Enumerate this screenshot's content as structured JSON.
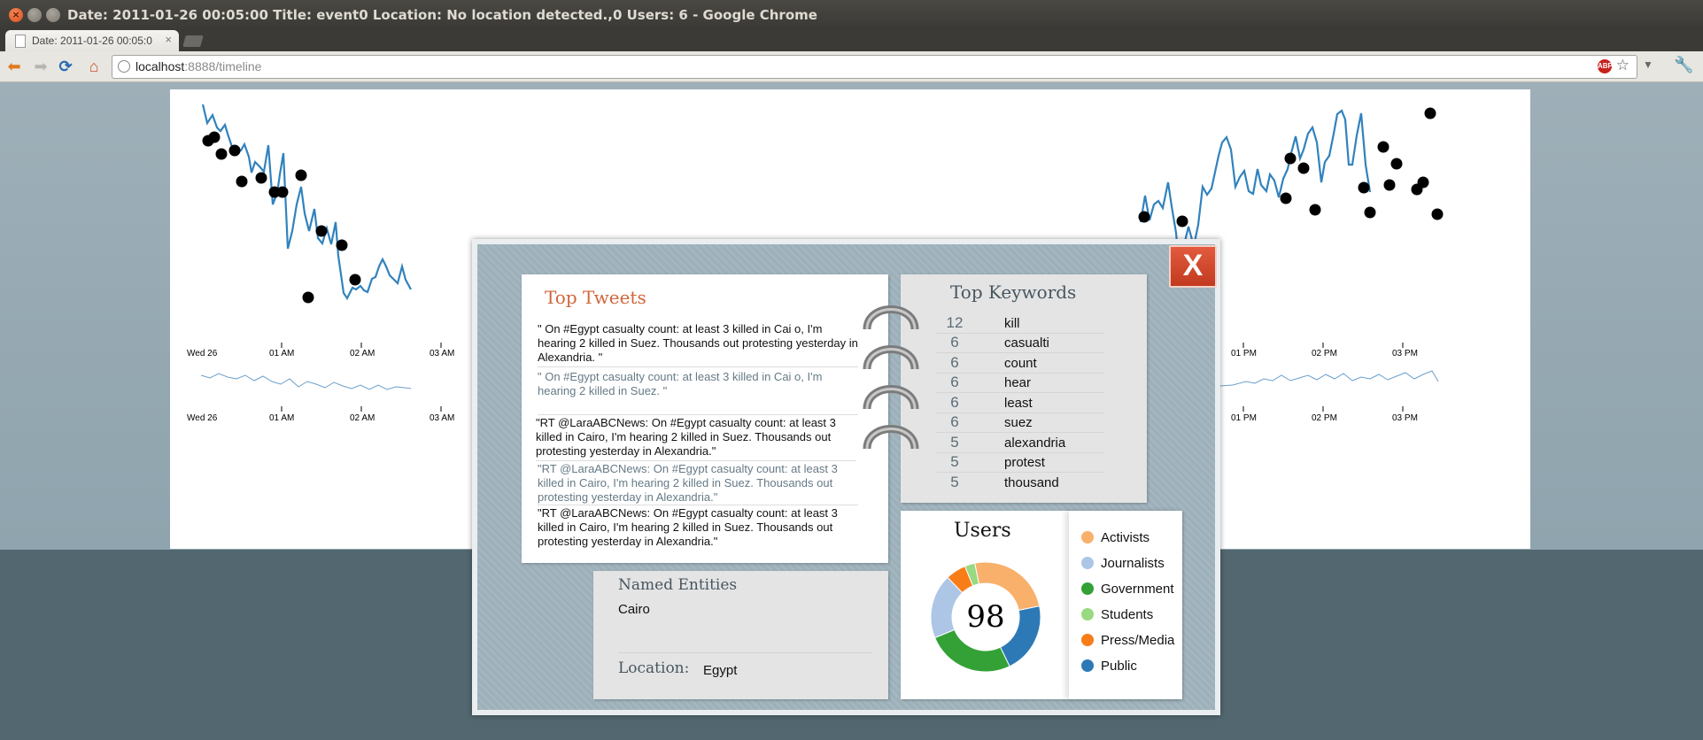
{
  "window": {
    "title": "Date: 2011-01-26 00:05:00 Title: event0 Location: No location detected.,0 Users: 6 - Google Chrome"
  },
  "tab": {
    "title": "Date: 2011-01-26 00:05:0",
    "close": "×"
  },
  "toolbar": {
    "back": "⬅",
    "forward": "➡",
    "reload": "⟳",
    "home": "⌂",
    "url_host": "localhost",
    "url_rest": ":8888/timeline",
    "abp": "ABP",
    "star": "☆",
    "menu": "▼",
    "wrench": "🔧"
  },
  "timeline": {
    "upper_axis_left": [
      "Wed 26",
      "01 AM",
      "02 AM",
      "03 AM"
    ],
    "upper_axis_right": [
      "01 PM",
      "02 PM",
      "03 PM"
    ],
    "lower_axis_left": [
      "Wed 26",
      "01 AM",
      "02 AM",
      "03 AM"
    ],
    "lower_axis_right": [
      "01 PM",
      "02 PM",
      "03 PM"
    ]
  },
  "popup": {
    "close_label": "X",
    "top_tweets": {
      "title": "Top Tweets",
      "tweets": [
        "\" On #Egypt casualty count: at least 3 killed in Cai o, I'm hearing 2 killed in Suez. Thousands out protesting yesterday in Alexandria. \"",
        "\" On #Egypt casualty count: at least 3 killed in Cai o, I'm hearing 2 killed in Suez. \"",
        "\"RT @LaraABCNews: On #Egypt casualty count: at least 3 killed in Cairo, I'm hearing 2 killed in Suez. Thousands out protesting yesterday in Alexandria.\"",
        "\"RT @LaraABCNews: On #Egypt casualty count: at least 3 killed in Cairo, I'm hearing 2 killed in Suez. Thousands out protesting yesterday in Alexandria.\"",
        "\"RT @LaraABCNews: On #Egypt casualty count: at least 3 killed in Cairo, I'm hearing 2 killed in Suez. Thousands out protesting yesterday in Alexandria.\""
      ]
    },
    "top_keywords": {
      "title": "Top Keywords",
      "rows": [
        {
          "count": "12",
          "word": "kill"
        },
        {
          "count": "6",
          "word": "casualti"
        },
        {
          "count": "6",
          "word": "count"
        },
        {
          "count": "6",
          "word": "hear"
        },
        {
          "count": "6",
          "word": "least"
        },
        {
          "count": "6",
          "word": "suez"
        },
        {
          "count": "5",
          "word": "alexandria"
        },
        {
          "count": "5",
          "word": "protest"
        },
        {
          "count": "5",
          "word": "thousand"
        }
      ]
    },
    "named_entities": {
      "title": "Named Entities",
      "items": [
        "Cairo"
      ],
      "location_label": "Location:",
      "location_value": "Egypt"
    },
    "users": {
      "title": "Users",
      "total": "98",
      "segments": [
        {
          "label": "Activists",
          "color": "#f9b06b",
          "value": 25
        },
        {
          "label": "Public",
          "color": "#2d79b6",
          "value": 21
        },
        {
          "label": "Government",
          "color": "#33a136",
          "value": 26
        },
        {
          "label": "Journalists",
          "color": "#adc6e6",
          "value": 19
        },
        {
          "label": "Press/Media",
          "color": "#f87d19",
          "value": 6
        },
        {
          "label": "Students",
          "color": "#98d981",
          "value": 3
        }
      ],
      "legend": [
        {
          "label": "Activists",
          "color": "#f9b06b"
        },
        {
          "label": "Journalists",
          "color": "#adc6e6"
        },
        {
          "label": "Government",
          "color": "#33a136"
        },
        {
          "label": "Students",
          "color": "#98d981"
        },
        {
          "label": "Press/Media",
          "color": "#f87d19"
        },
        {
          "label": "Public",
          "color": "#2d79b6"
        }
      ]
    }
  }
}
